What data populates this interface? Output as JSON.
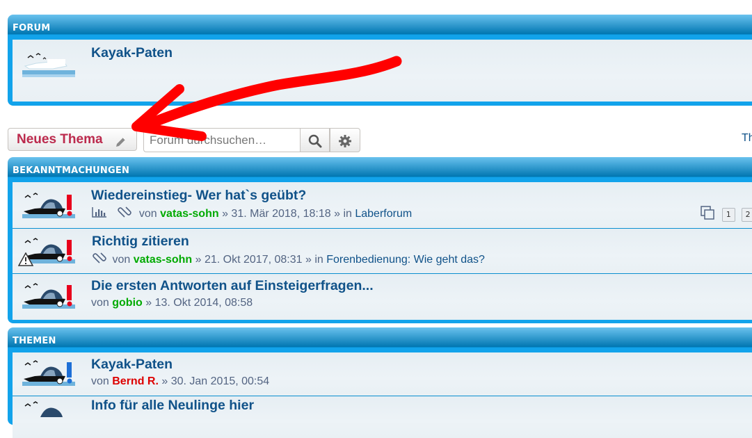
{
  "forum_panel": {
    "header": "FORUM",
    "rows": [
      {
        "title": "Kayak-Paten"
      }
    ]
  },
  "actions": {
    "new_topic_label": "Neues Thema",
    "search_placeholder": "Forum durchsuchen…",
    "right_link": "Th"
  },
  "announcements": {
    "header": "BEKANNTMACHUNGEN",
    "rows": [
      {
        "title": "Wiedereinstieg- Wer hat`s geübt?",
        "by": "von",
        "author": "vatas-sohn",
        "date": "» 31. Mär 2018, 18:18 »",
        "in": "in",
        "forum": "Laberforum",
        "pages": [
          "1",
          "2"
        ]
      },
      {
        "title": "Richtig zitieren",
        "by": "von",
        "author": "vatas-sohn",
        "date": "» 21. Okt 2017, 08:31 »",
        "in": "in",
        "forum": "Forenbedienung: Wie geht das?"
      },
      {
        "title": "Die ersten Antworten auf Einsteigerfragen...",
        "by": "von",
        "author": "gobio",
        "date": "» 13. Okt 2014, 08:58"
      }
    ]
  },
  "topics": {
    "header": "THEMEN",
    "rows": [
      {
        "title": "Kayak-Paten",
        "by": "von",
        "author": "Bernd R.",
        "date": "» 30. Jan 2015, 00:54"
      },
      {
        "title": "Info für alle Neulinge hier"
      }
    ]
  },
  "colors": {
    "panel_blue": "#12a3eb",
    "title_blue": "#105289",
    "moderator_green": "#00aa00",
    "admin_red": "#dd0000",
    "new_topic_red": "#bc2a4d",
    "annotation_arrow": "#ff0000"
  },
  "icons": [
    "forum-read-icon",
    "announcement-icon",
    "topic-icon",
    "poll-icon",
    "attachment-icon",
    "warning-icon",
    "pagination-icon",
    "pencil-icon",
    "search-icon",
    "gear-icon"
  ]
}
